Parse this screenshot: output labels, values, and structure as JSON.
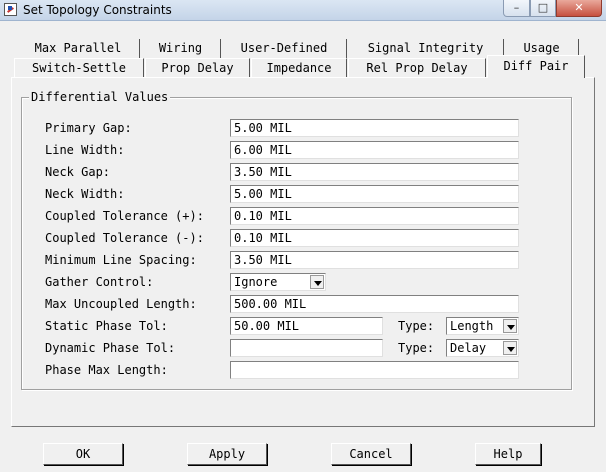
{
  "window": {
    "title": "Set Topology Constraints",
    "min_glyph": "–",
    "max_glyph": "□",
    "close_glyph": "✕"
  },
  "tabs_row1": [
    "Max Parallel",
    "Wiring",
    "User-Defined",
    "Signal Integrity",
    "Usage"
  ],
  "tabs_row2": [
    "Switch-Settle",
    "Prop Delay",
    "Impedance",
    "Rel Prop Delay",
    "Diff Pair"
  ],
  "active_tab": "Diff Pair",
  "group": {
    "title": "Differential Values"
  },
  "fields": {
    "primary_gap": {
      "label": "Primary Gap:",
      "value": "5.00 MIL"
    },
    "line_width": {
      "label": "Line Width:",
      "value": "6.00 MIL"
    },
    "neck_gap": {
      "label": "Neck Gap:",
      "value": "3.50 MIL"
    },
    "neck_width": {
      "label": "Neck Width:",
      "value": "5.00 MIL"
    },
    "coupled_tol_plus": {
      "label": "Coupled Tolerance (+):",
      "value": "0.10 MIL"
    },
    "coupled_tol_minus": {
      "label": "Coupled Tolerance (-):",
      "value": "0.10 MIL"
    },
    "min_line_spacing": {
      "label": "Minimum Line Spacing:",
      "value": "3.50 MIL"
    },
    "gather_control": {
      "label": "Gather Control:",
      "value": "Ignore"
    },
    "max_uncoupled_length": {
      "label": "Max Uncoupled Length:",
      "value": "500.00 MIL"
    },
    "static_phase_tol": {
      "label": "Static Phase Tol:",
      "value": "50.00 MIL",
      "type_label": "Type:",
      "type_value": "Length"
    },
    "dynamic_phase_tol": {
      "label": "Dynamic Phase Tol:",
      "value": "",
      "type_label": "Type:",
      "type_value": "Delay"
    },
    "phase_max_length": {
      "label": "Phase Max Length:",
      "value": ""
    }
  },
  "buttons": {
    "ok": "OK",
    "apply": "Apply",
    "cancel": "Cancel",
    "help": "Help"
  }
}
